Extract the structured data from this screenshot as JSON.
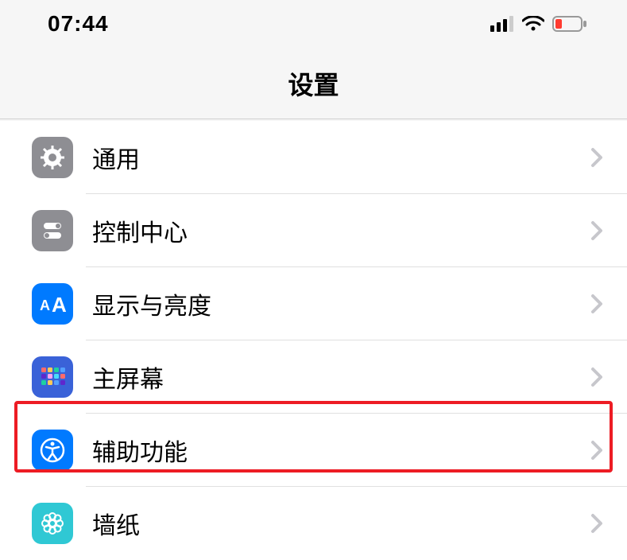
{
  "status": {
    "time": "07:44"
  },
  "nav": {
    "title": "设置"
  },
  "rows": {
    "general": "通用",
    "control_center": "控制中心",
    "display": "显示与亮度",
    "home": "主屏幕",
    "accessibility": "辅助功能",
    "wallpaper": "墙纸"
  },
  "highlight": {
    "target": "accessibility"
  }
}
